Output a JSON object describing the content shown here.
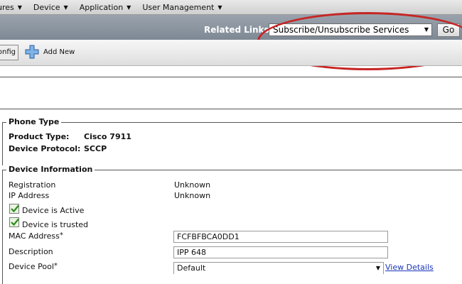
{
  "menubar": {
    "items": [
      {
        "label": "ures"
      },
      {
        "label": "Device"
      },
      {
        "label": "Application"
      },
      {
        "label": "User Management"
      }
    ]
  },
  "related_links": {
    "label": "Related Links:",
    "selected": "Subscribe/Unsubscribe Services",
    "go_label": "Go"
  },
  "toolbar": {
    "config_label": "onfig",
    "add_new_label": "Add New"
  },
  "phone_type": {
    "legend": "Phone Type",
    "product_type_label": "Product Type:",
    "product_type_value": "Cisco 7911",
    "device_protocol_label": "Device Protocol:",
    "device_protocol_value": "SCCP"
  },
  "device_info": {
    "legend": "Device Information",
    "registration_label": "Registration",
    "registration_value": "Unknown",
    "ip_label": "IP Address",
    "ip_value": "Unknown",
    "active_label": "Device is Active",
    "trusted_label": "Device is trusted",
    "mac_label": "MAC Address",
    "mac_value": "FCFBFBCA0DD1",
    "description_label": "Description",
    "description_value": "IPP 648",
    "pool_label": "Device Pool",
    "pool_value": "Default",
    "view_details_label": "View Details",
    "required_mark": "*"
  },
  "colors": {
    "highlight": "#c62525",
    "link": "#1a35b8",
    "linkbar": "#8a939e"
  }
}
